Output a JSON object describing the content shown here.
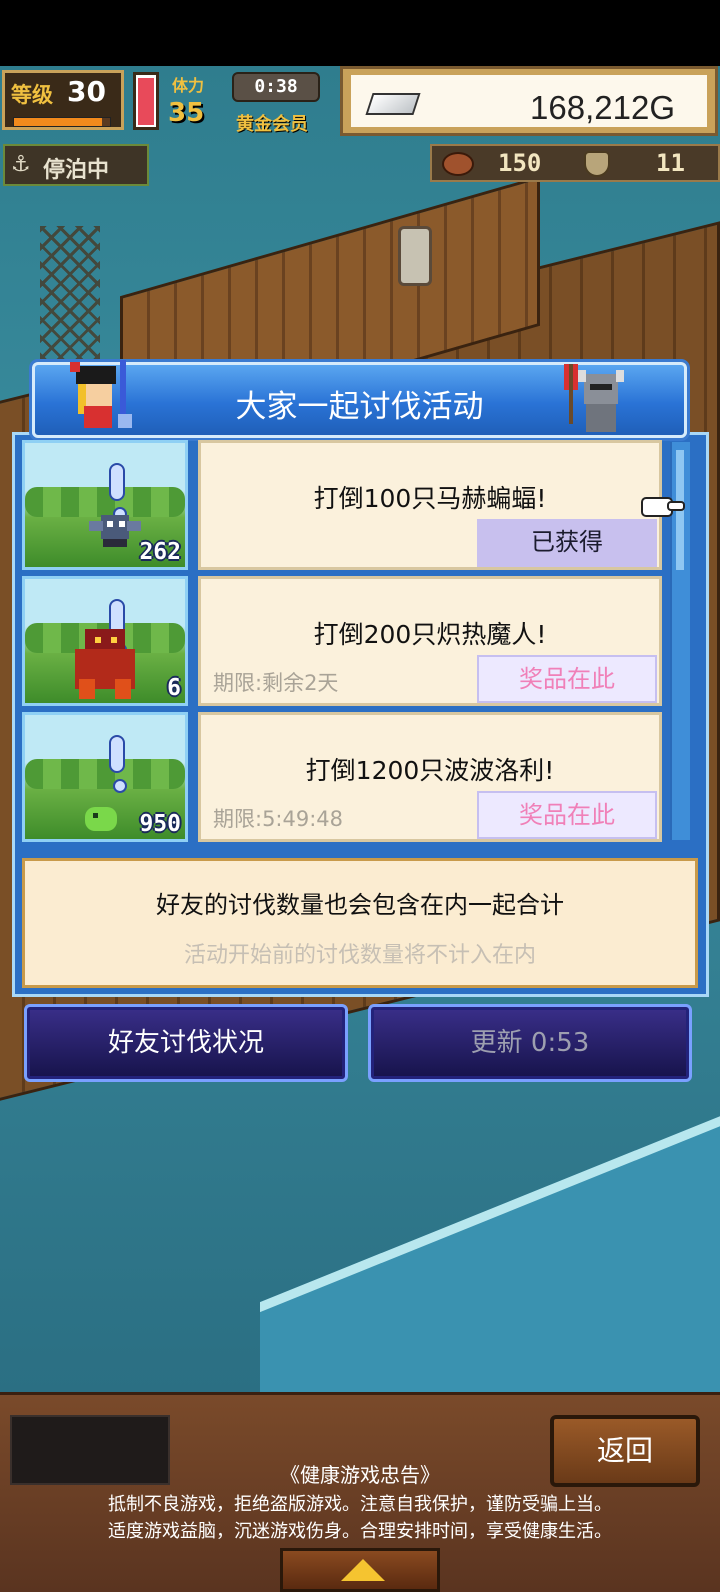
{
  "hud": {
    "level_label": "等级",
    "level": "30",
    "level_progress": 0.92,
    "stamina_level": 0.9,
    "member_label": "体力",
    "member_value": "35",
    "timer": "0:38",
    "member_status": "黄金会员",
    "gold": "168,212G",
    "dock_status": "停泊中",
    "meat": "150",
    "shield": "11"
  },
  "event": {
    "title": "大家一起讨伐活动",
    "quests": [
      {
        "title": "打倒100只马赫蝙蝠!",
        "count": "262",
        "deadline": "",
        "status": "已获得"
      },
      {
        "title": "打倒200只炽热魔人!",
        "count": "6",
        "deadline": "期限:剩余2天",
        "status": "奖品在此"
      },
      {
        "title": "打倒1200只波波洛利!",
        "count": "950",
        "deadline": "期限:5:49:48",
        "status": "奖品在此"
      }
    ],
    "note_main": "好友的讨伐数量也会包含在内一起合计",
    "note_sub": "活动开始前的讨伐数量将不计入在内",
    "friend_button": "好友讨伐状况",
    "refresh_button": "更新 0:53"
  },
  "bottom": {
    "back": "返回",
    "health_title": "《健康游戏忠告》",
    "health_line1": "抵制不良游戏，拒绝盗版游戏。注意自我保护，谨防受骗上当。",
    "health_line2": "适度游戏益脑，沉迷游戏伤身。合理安排时间，享受健康生活。"
  },
  "icons": {
    "anchor": "anchor-icon",
    "silver_bar": "silver-bar-icon",
    "meat": "meat-icon",
    "shield": "shield-icon",
    "hand": "hand-pointer-icon",
    "up": "up-arrow-icon"
  },
  "colors": {
    "panel_blue": "#2b6fc4",
    "prize_pink": "#f080b8",
    "got_purple": "#c8c0ee"
  }
}
